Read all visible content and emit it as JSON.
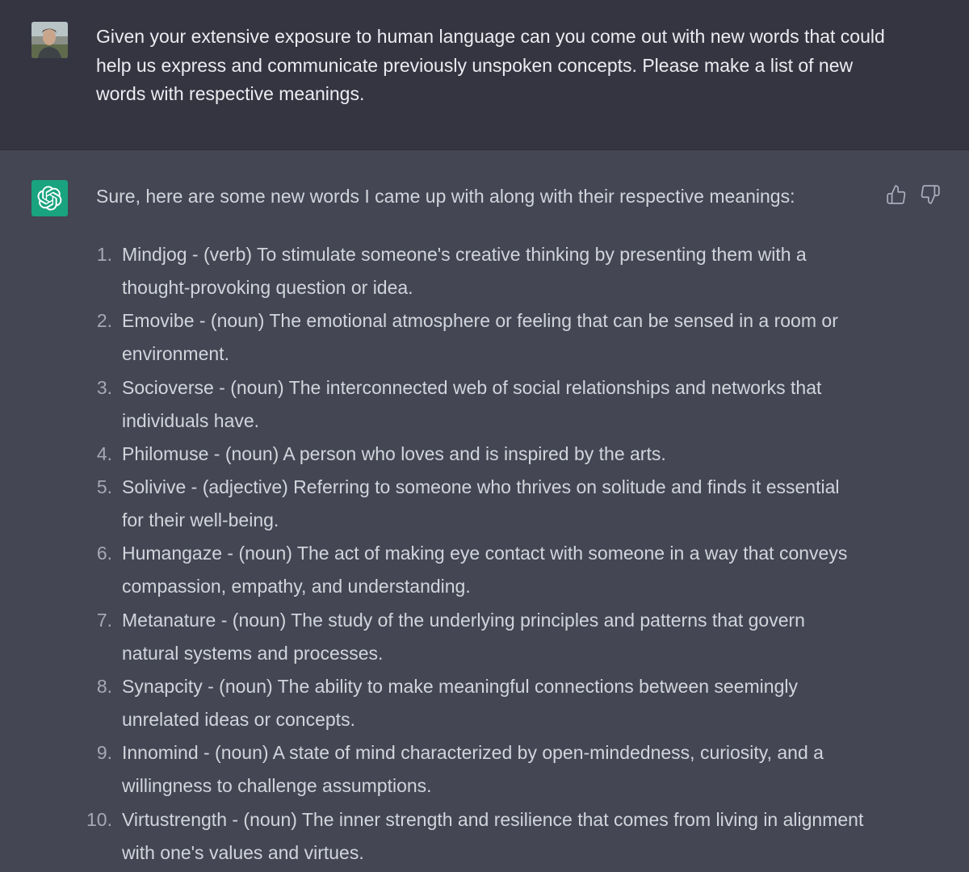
{
  "colors": {
    "user_bg": "#343541",
    "assistant_bg": "#444654",
    "bot_avatar_bg": "#19a37f",
    "text": "#d1d5db"
  },
  "user_message": {
    "avatar_icon": "user-photo-avatar",
    "text": "Given your extensive exposure to human language can you come out with new words that could help us express and communicate previously unspoken concepts. Please make a list of new words with respective meanings."
  },
  "assistant_message": {
    "avatar_icon": "openai-logo-icon",
    "intro": "Sure, here are some new words I came up with along with their respective meanings:",
    "feedback": {
      "thumbs_up_icon": "thumbs-up-icon",
      "thumbs_down_icon": "thumbs-down-icon"
    },
    "items": [
      {
        "num": "1.",
        "text": "Mindjog - (verb) To stimulate someone's creative thinking by presenting them with a thought-provoking question or idea."
      },
      {
        "num": "2.",
        "text": "Emovibe - (noun) The emotional atmosphere or feeling that can be sensed in a room or environment."
      },
      {
        "num": "3.",
        "text": "Socioverse - (noun) The interconnected web of social relationships and networks that individuals have."
      },
      {
        "num": "4.",
        "text": "Philomuse - (noun) A person who loves and is inspired by the arts."
      },
      {
        "num": "5.",
        "text": "Solivive - (adjective) Referring to someone who thrives on solitude and finds it essential for their well-being."
      },
      {
        "num": "6.",
        "text": "Humangaze - (noun) The act of making eye contact with someone in a way that conveys compassion, empathy, and understanding."
      },
      {
        "num": "7.",
        "text": "Metanature - (noun) The study of the underlying principles and patterns that govern natural systems and processes."
      },
      {
        "num": "8.",
        "text": "Synapcity - (noun) The ability to make meaningful connections between seemingly unrelated ideas or concepts."
      },
      {
        "num": "9.",
        "text": "Innomind - (noun) A state of mind characterized by open-mindedness, curiosity, and a willingness to challenge assumptions."
      },
      {
        "num": "10.",
        "text": "Virtustrength - (noun) The inner strength and resilience that comes from living in alignment with one's values and virtues."
      }
    ]
  }
}
